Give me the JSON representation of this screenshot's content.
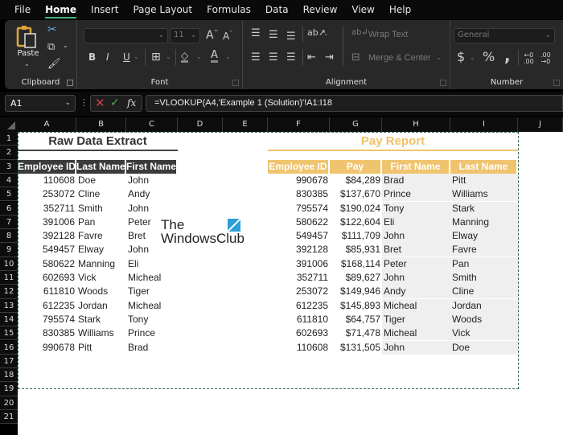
{
  "menu": {
    "tabs": [
      "File",
      "Home",
      "Insert",
      "Page Layout",
      "Formulas",
      "Data",
      "Review",
      "View",
      "Help"
    ],
    "active": "Home"
  },
  "ribbon": {
    "clipboard": {
      "label": "Clipboard",
      "paste": "Paste"
    },
    "font": {
      "label": "Font",
      "font_name": "",
      "font_size": "11",
      "bold": "B",
      "italic": "I",
      "underline": "U"
    },
    "alignment": {
      "label": "Alignment",
      "wrap_text": "Wrap Text",
      "merge_center": "Merge & Center"
    },
    "number": {
      "label": "Number",
      "format": "General",
      "currency": "$",
      "percent": "%",
      "comma": ","
    }
  },
  "formula_bar": {
    "name_box": "A1",
    "formula": "=VLOOKUP(A4,'Example 1 (Solution)'!A1:I18",
    "fx": "fx"
  },
  "columns": [
    "A",
    "B",
    "C",
    "D",
    "E",
    "F",
    "G",
    "H",
    "I",
    "J"
  ],
  "rows": [
    "1",
    "2",
    "3",
    "4",
    "5",
    "6",
    "7",
    "8",
    "9",
    "10",
    "11",
    "12",
    "13",
    "14",
    "15",
    "16",
    "17",
    "18",
    "19",
    "20",
    "21"
  ],
  "raw_data": {
    "title": "Raw Data Extract",
    "headers": [
      "Employee ID",
      "Last Name",
      "First Name"
    ],
    "rows": [
      [
        "110608",
        "Doe",
        "John"
      ],
      [
        "253072",
        "Cline",
        "Andy"
      ],
      [
        "352711",
        "Smith",
        "John"
      ],
      [
        "391006",
        "Pan",
        "Peter"
      ],
      [
        "392128",
        "Favre",
        "Bret"
      ],
      [
        "549457",
        "Elway",
        "John"
      ],
      [
        "580622",
        "Manning",
        "Eli"
      ],
      [
        "602693",
        "Vick",
        "Micheal"
      ],
      [
        "611810",
        "Woods",
        "Tiger"
      ],
      [
        "612235",
        "Jordan",
        "Micheal"
      ],
      [
        "795574",
        "Stark",
        "Tony"
      ],
      [
        "830385",
        "Williams",
        "Prince"
      ],
      [
        "990678",
        "Pitt",
        "Brad"
      ]
    ]
  },
  "pay_report": {
    "title": "Pay Report",
    "headers": [
      "Employee ID",
      "Pay",
      "First Name",
      "Last Name"
    ],
    "rows": [
      [
        "990678",
        "$84,289",
        "Brad",
        "Pitt"
      ],
      [
        "830385",
        "$137,670",
        "Prince",
        "Williams"
      ],
      [
        "795574",
        "$190,024",
        "Tony",
        "Stark"
      ],
      [
        "580622",
        "$122,604",
        "Eli",
        "Manning"
      ],
      [
        "549457",
        "$111,709",
        "John",
        "Elway"
      ],
      [
        "392128",
        "$85,931",
        "Bret",
        "Favre"
      ],
      [
        "391006",
        "$168,114",
        "Peter",
        "Pan"
      ],
      [
        "352711",
        "$89,627",
        "John",
        "Smith"
      ],
      [
        "253072",
        "$149,946",
        "Andy",
        "Cline"
      ],
      [
        "612235",
        "$145,893",
        "Micheal",
        "Jordan"
      ],
      [
        "611810",
        "$64,757",
        "Tiger",
        "Woods"
      ],
      [
        "602693",
        "$71,478",
        "Micheal",
        "Vick"
      ],
      [
        "110608",
        "$131,505",
        "John",
        "Doe"
      ]
    ]
  },
  "watermark": {
    "line1": "The",
    "line2": "WindowsClub"
  },
  "colors": {
    "accent_gold": "#f0c46e",
    "header_dark": "#3b3b3b",
    "selection_green": "#2f6b4a",
    "tab_underline": "#4caf7a"
  }
}
